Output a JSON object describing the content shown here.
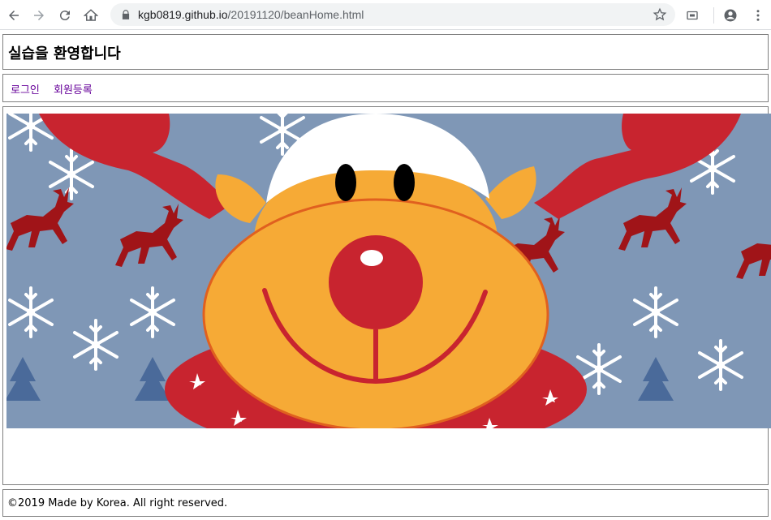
{
  "browser": {
    "url_host": "kgb0819.github.io",
    "url_path": "/20191120/beanHome.html"
  },
  "header": {
    "title": "실습을 환영합니다"
  },
  "nav": {
    "login": "로그인",
    "signup": "회원등록"
  },
  "banner": {
    "image": "reindeer-christmas-illustration",
    "colors": {
      "background": "#7f97b6",
      "antler": "#c8242f",
      "face": "#f6aa36",
      "nose": "#c8242f",
      "hat": "#ffffff",
      "reindeer_pattern": "#a01418"
    }
  },
  "footer": {
    "text": "©2019 Made by Korea. All right reserved."
  }
}
